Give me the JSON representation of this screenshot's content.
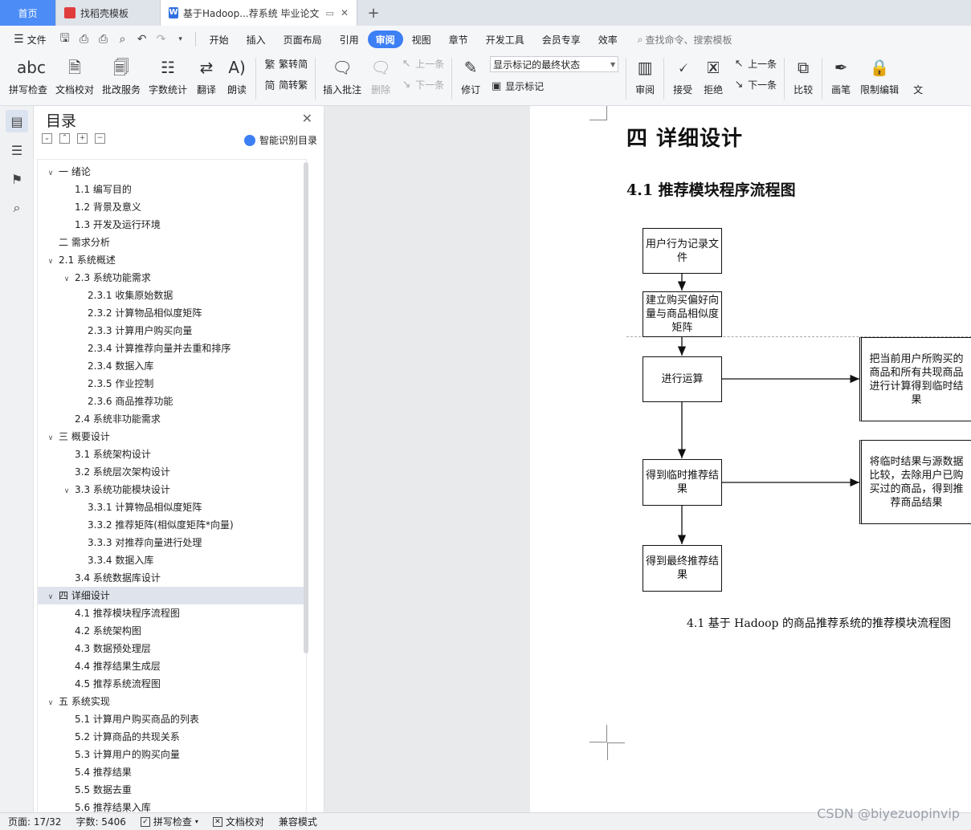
{
  "tabs": {
    "home": "首页",
    "template": "找稻壳模板",
    "document": "基于Hadoop...荐系统 毕业论文",
    "add": "+"
  },
  "ribbon_tabs": {
    "file": "文件",
    "items": [
      "开始",
      "插入",
      "页面布局",
      "引用",
      "审阅",
      "视图",
      "章节",
      "开发工具",
      "会员专享",
      "效率"
    ],
    "active_index": 4,
    "search": "查找命令、搜索模板"
  },
  "ribbon": {
    "spell_check": "拼写检查",
    "doc_proof": "文档校对",
    "batch_service": "批改服务",
    "word_count": "字数统计",
    "translate": "翻译",
    "read_aloud": "朗读",
    "to_traditional": "繁转简",
    "to_simplified": "简转繁",
    "insert_comment": "插入批注",
    "delete": "删除",
    "prev": "上一条",
    "next": "下一条",
    "revise": "修订",
    "markup_state": "显示标记的最终状态",
    "show_markup": "显示标记",
    "review": "审阅",
    "accept": "接受",
    "reject": "拒绝",
    "prev2": "上一条",
    "next2": "下一条",
    "compare": "比较",
    "pen": "画笔",
    "restrict_edit": "限制编辑",
    "doc_rights": "文"
  },
  "toc": {
    "title": "目录",
    "smart": "智能识别目录",
    "items": [
      {
        "text": "一  绪论",
        "level": 0,
        "chev": "v"
      },
      {
        "text": "1.1  编写目的",
        "level": 1
      },
      {
        "text": "1.2  背景及意义",
        "level": 1
      },
      {
        "text": "1.3  开发及运行环境",
        "level": 1
      },
      {
        "text": "二  需求分析",
        "level": 0
      },
      {
        "text": "2.1  系统概述",
        "level": 0,
        "chev": "v"
      },
      {
        "text": "2.3  系统功能需求",
        "level": 1,
        "chev": "v"
      },
      {
        "text": "2.3.1  收集原始数据",
        "level": 2
      },
      {
        "text": "2.3.2  计算物品相似度矩阵",
        "level": 2
      },
      {
        "text": "2.3.3  计算用户购买向量",
        "level": 2
      },
      {
        "text": "2.3.4  计算推荐向量并去重和排序",
        "level": 2
      },
      {
        "text": "2.3.4  数据入库",
        "level": 2
      },
      {
        "text": "2.3.5  作业控制",
        "level": 2
      },
      {
        "text": "2.3.6 商品推荐功能",
        "level": 2
      },
      {
        "text": "2.4  系统非功能需求",
        "level": 1
      },
      {
        "text": "三  概要设计",
        "level": 0,
        "chev": "v"
      },
      {
        "text": "3.1 系统架构设计",
        "level": 1
      },
      {
        "text": "3.2 系统层次架构设计",
        "level": 1
      },
      {
        "text": "3.3 系统功能模块设计",
        "level": 1,
        "chev": "v"
      },
      {
        "text": "3.3.1  计算物品相似度矩阵",
        "level": 2
      },
      {
        "text": "3.3.2 推荐矩阵(相似度矩阵*向量)",
        "level": 2
      },
      {
        "text": "3.3.3 对推荐向量进行处理",
        "level": 2
      },
      {
        "text": "3.3.4 数据入库",
        "level": 2
      },
      {
        "text": "3.4 系统数据库设计",
        "level": 1
      },
      {
        "text": "四  详细设计",
        "level": 0,
        "chev": "v",
        "selected": true
      },
      {
        "text": "4.1 推荐模块程序流程图",
        "level": 1
      },
      {
        "text": "4.2 系统架构图",
        "level": 1
      },
      {
        "text": "4.3 数据预处理层",
        "level": 1
      },
      {
        "text": "4.4 推荐结果生成层",
        "level": 1
      },
      {
        "text": "4.5 推荐系统流程图",
        "level": 1
      },
      {
        "text": "五  系统实现",
        "level": 0,
        "chev": "v"
      },
      {
        "text": "5.1 计算用户购买商品的列表",
        "level": 1
      },
      {
        "text": "5.2 计算商品的共现关系",
        "level": 1
      },
      {
        "text": "5.3 计算用户的购买向量",
        "level": 1
      },
      {
        "text": "5.4 推荐结果",
        "level": 1
      },
      {
        "text": "5.5 数据去重",
        "level": 1
      },
      {
        "text": "5.6 推荐结果入库",
        "level": 1
      }
    ]
  },
  "document": {
    "chapter_title": "四  详细设计",
    "section_title": "4.1 推荐模块程序流程图",
    "flow": {
      "box1": "用户行为记录文件",
      "box2": "建立购买偏好向量与商品相似度矩阵",
      "box3": "进行运算",
      "box4": "得到临时推荐结果",
      "box5": "得到最终推荐结果",
      "side1": "把当前用户所购买的商品和所有共现商品进行计算得到临时结果",
      "side2": "将临时结果与源数据比较，去除用户已购买过的商品，得到推荐商品结果"
    },
    "caption": "4.1 基于 Hadoop 的商品推荐系统的推荐模块流程图"
  },
  "status": {
    "page": "页面: 17/32",
    "words": "字数: 5406",
    "spell": "拼写检查",
    "proof": "文档校对",
    "compat": "兼容模式"
  },
  "watermark": "CSDN @biyezuopinvip"
}
